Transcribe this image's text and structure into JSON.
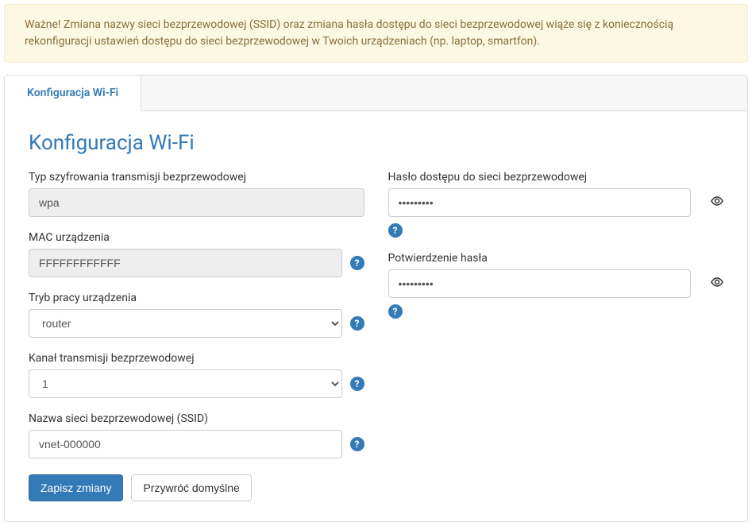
{
  "alert": {
    "text": "Ważne! Zmiana nazwy sieci bezprzewodowej (SSID) oraz zmiana hasła dostępu do sieci bezprzewodowej wiąże się z koniecznością rekonfiguracji ustawień dostępu do sieci bezprzewodowej w Twoich urządzeniach (np. laptop, smartfon)."
  },
  "tabs": {
    "wifi_config": "Konfiguracja Wi-Fi"
  },
  "heading": "Konfiguracja Wi-Fi",
  "form": {
    "encryption": {
      "label": "Typ szyfrowania transmisji bezprzewodowej",
      "value": "wpa"
    },
    "mac": {
      "label": "MAC urządzenia",
      "value": "FFFFFFFFFFFF"
    },
    "mode": {
      "label": "Tryb pracy urządzenia",
      "value": "router"
    },
    "channel": {
      "label": "Kanał transmisji bezprzewodowej",
      "value": "1"
    },
    "ssid": {
      "label": "Nazwa sieci bezprzewodowej (SSID)",
      "value": "vnet-000000"
    },
    "password": {
      "label": "Hasło dostępu do sieci bezprzewodowej",
      "value": "•••••••••"
    },
    "password_confirm": {
      "label": "Potwierdzenie hasła",
      "value": "•••••••••"
    }
  },
  "buttons": {
    "save": "Zapisz zmiany",
    "restore": "Przywróć domyślne"
  },
  "icons": {
    "help": "?",
    "eye": "👁"
  }
}
